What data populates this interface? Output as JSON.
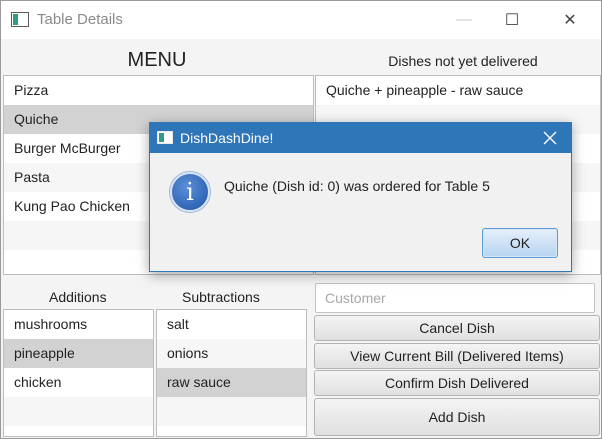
{
  "window": {
    "title": "Table Details",
    "controls": {
      "minimize": "—",
      "maximize": "☐",
      "close": "✕"
    }
  },
  "menu": {
    "heading": "MENU",
    "items": [
      {
        "label": "Pizza"
      },
      {
        "label": "Quiche",
        "selected": true
      },
      {
        "label": "Burger McBurger"
      },
      {
        "label": "Pasta"
      },
      {
        "label": "Kung Pao Chicken"
      }
    ]
  },
  "pending": {
    "heading": "Dishes not yet delivered",
    "items": [
      {
        "label": "Quiche + pineapple - raw sauce"
      }
    ]
  },
  "additions": {
    "heading": "Additions",
    "items": [
      {
        "label": "mushrooms"
      },
      {
        "label": "pineapple",
        "selected": true
      },
      {
        "label": "chicken"
      }
    ]
  },
  "subtractions": {
    "heading": "Subtractions",
    "items": [
      {
        "label": "salt"
      },
      {
        "label": "onions"
      },
      {
        "label": "raw sauce",
        "selected": true
      }
    ]
  },
  "customer": {
    "placeholder": "Customer",
    "value": ""
  },
  "actions": {
    "cancel": "Cancel Dish",
    "bill": "View Current Bill (Delivered Items)",
    "confirm": "Confirm Dish Delivered",
    "add": "Add Dish"
  },
  "dialog": {
    "title": "DishDashDine!",
    "icon": "i",
    "message": "Quiche (Dish id: 0) was ordered for Table 5",
    "ok": "OK"
  },
  "colors": {
    "dialog_titlebar": "#2f76b8",
    "selection": "#d2d2d2",
    "ok_button": "#b6d3f0"
  }
}
